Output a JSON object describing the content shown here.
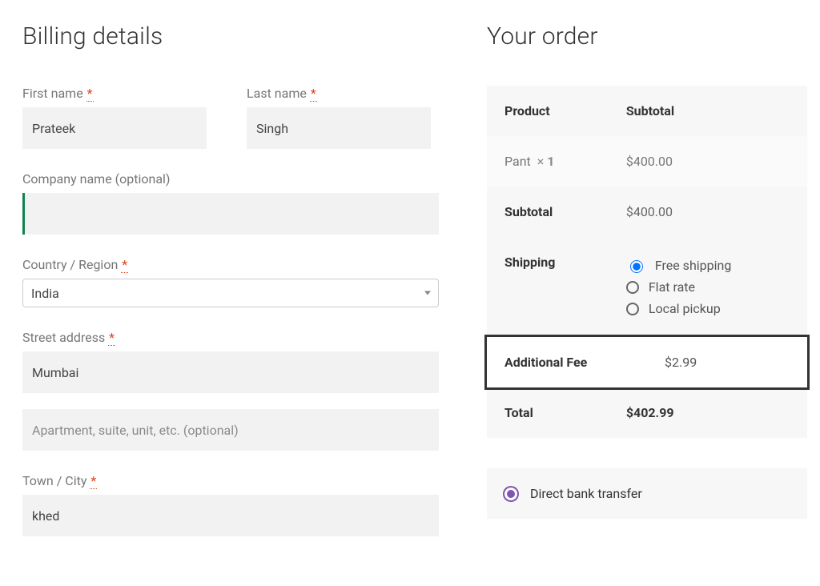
{
  "billing": {
    "heading": "Billing details",
    "first_name": {
      "label": "First name",
      "value": "Prateek"
    },
    "last_name": {
      "label": "Last name",
      "value": "Singh"
    },
    "company": {
      "label": "Company name (optional)",
      "value": ""
    },
    "country": {
      "label": "Country / Region",
      "value": "India"
    },
    "street": {
      "label": "Street address",
      "value": "Mumbai"
    },
    "street2_placeholder": "Apartment, suite, unit, etc. (optional)",
    "city": {
      "label": "Town / City",
      "value": "khed"
    },
    "required_mark": "*"
  },
  "order": {
    "heading": "Your order",
    "columns": {
      "product": "Product",
      "subtotal": "Subtotal"
    },
    "items": [
      {
        "name": "Pant",
        "qty_prefix": "× ",
        "qty": "1",
        "subtotal": "$400.00"
      }
    ],
    "subtotal": {
      "label": "Subtotal",
      "value": "$400.00"
    },
    "shipping": {
      "label": "Shipping",
      "options": [
        {
          "label": "Free shipping",
          "selected": true
        },
        {
          "label": "Flat rate",
          "selected": false
        },
        {
          "label": "Local pickup",
          "selected": false
        }
      ]
    },
    "additional_fee": {
      "label": "Additional Fee",
      "value": "$2.99"
    },
    "total": {
      "label": "Total",
      "value": "$402.99"
    },
    "payment": {
      "option_label": "Direct bank transfer"
    }
  }
}
